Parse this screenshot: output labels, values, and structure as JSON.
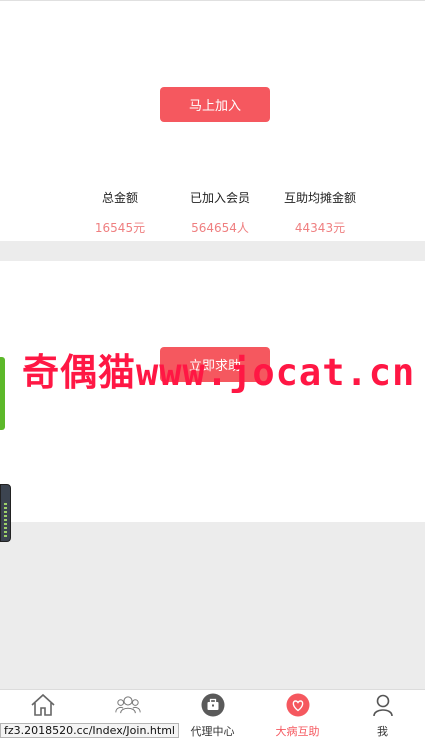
{
  "join_section": {
    "join_button": "马上加入",
    "stats": [
      {
        "label": "总金额",
        "value": "16545元"
      },
      {
        "label": "已加入会员",
        "value": "564654人"
      },
      {
        "label": "互助均摊金额",
        "value": "44343元"
      }
    ]
  },
  "help_section": {
    "help_button": "立即求助"
  },
  "watermark": "奇偶猫www.jocat.cn",
  "tabbar": {
    "tabs": [
      {
        "label": "",
        "icon": "home-icon"
      },
      {
        "label": "",
        "icon": "users-icon"
      },
      {
        "label": "代理中心",
        "icon": "briefcase-icon"
      },
      {
        "label": "大病互助",
        "icon": "heart-icon",
        "active": true
      },
      {
        "label": "我",
        "icon": "person-icon"
      }
    ]
  },
  "status_url": "fz3.2018520.cc/Index/Join.html",
  "colors": {
    "accent": "#f5585f",
    "value": "#ef7f80",
    "background": "#ececec"
  }
}
